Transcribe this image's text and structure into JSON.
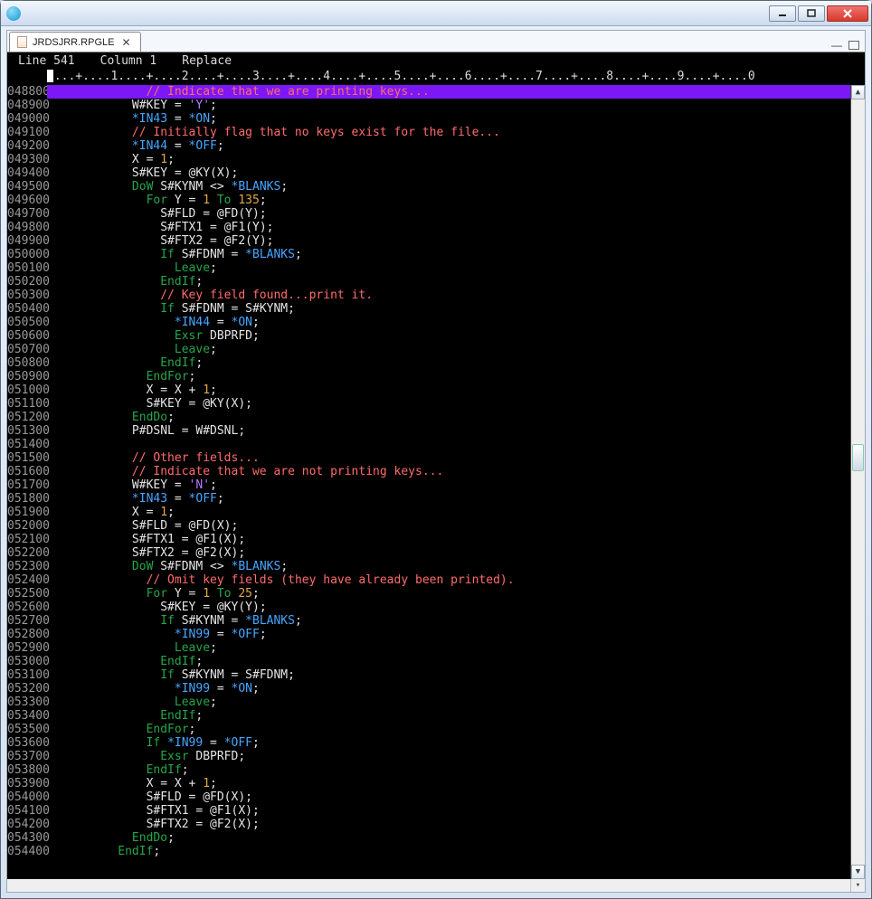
{
  "window": {
    "title": ""
  },
  "tab": {
    "label": "JRDSJRR.RPGLE"
  },
  "status": {
    "line_label": "Line",
    "line": "541",
    "col_label": "Column",
    "col": "1",
    "mode": "Replace"
  },
  "ruler": "....+....1....+....2....+....3....+....4....+....5....+....6....+....7....+....8....+....9....+....0",
  "code": [
    {
      "n": "048800",
      "sel": true,
      "segs": [
        [
          "sp",
          "              "
        ],
        [
          "c-comment",
          "// Indicate that we are printing keys..."
        ]
      ]
    },
    {
      "n": "048900",
      "segs": [
        [
          "sp",
          "            "
        ],
        [
          "c-id",
          "W#KEY "
        ],
        [
          "c-op",
          "= "
        ],
        [
          "c-str",
          "'Y'"
        ],
        [
          "c-id",
          ";"
        ]
      ]
    },
    {
      "n": "049000",
      "segs": [
        [
          "sp",
          "            "
        ],
        [
          "c-sp",
          "*IN43 "
        ],
        [
          "c-op",
          "= "
        ],
        [
          "c-sp",
          "*ON"
        ],
        [
          "c-id",
          ";"
        ]
      ]
    },
    {
      "n": "049100",
      "segs": [
        [
          "sp",
          "            "
        ],
        [
          "c-comment",
          "// Initially flag that no keys exist for the file..."
        ]
      ]
    },
    {
      "n": "049200",
      "segs": [
        [
          "sp",
          "            "
        ],
        [
          "c-sp",
          "*IN44 "
        ],
        [
          "c-op",
          "= "
        ],
        [
          "c-sp",
          "*OFF"
        ],
        [
          "c-id",
          ";"
        ]
      ]
    },
    {
      "n": "049300",
      "segs": [
        [
          "sp",
          "            "
        ],
        [
          "c-id",
          "X "
        ],
        [
          "c-op",
          "= "
        ],
        [
          "c-num",
          "1"
        ],
        [
          "c-id",
          ";"
        ]
      ]
    },
    {
      "n": "049400",
      "segs": [
        [
          "sp",
          "            "
        ],
        [
          "c-id",
          "S#KEY "
        ],
        [
          "c-op",
          "= "
        ],
        [
          "c-id",
          "@KY(X);"
        ]
      ]
    },
    {
      "n": "049500",
      "segs": [
        [
          "sp",
          "            "
        ],
        [
          "c-kw",
          "DoW "
        ],
        [
          "c-id",
          "S#KYNM "
        ],
        [
          "c-op",
          "<> "
        ],
        [
          "c-sp",
          "*BLANKS"
        ],
        [
          "c-id",
          ";"
        ]
      ]
    },
    {
      "n": "049600",
      "segs": [
        [
          "sp",
          "              "
        ],
        [
          "c-kw",
          "For "
        ],
        [
          "c-id",
          "Y "
        ],
        [
          "c-op",
          "= "
        ],
        [
          "c-num",
          "1"
        ],
        [
          "c-kw",
          " To "
        ],
        [
          "c-num",
          "135"
        ],
        [
          "c-id",
          ";"
        ]
      ]
    },
    {
      "n": "049700",
      "segs": [
        [
          "sp",
          "                "
        ],
        [
          "c-id",
          "S#FLD "
        ],
        [
          "c-op",
          "= "
        ],
        [
          "c-id",
          "@FD(Y);"
        ]
      ]
    },
    {
      "n": "049800",
      "segs": [
        [
          "sp",
          "                "
        ],
        [
          "c-id",
          "S#FTX1 "
        ],
        [
          "c-op",
          "= "
        ],
        [
          "c-id",
          "@F1(Y);"
        ]
      ]
    },
    {
      "n": "049900",
      "segs": [
        [
          "sp",
          "                "
        ],
        [
          "c-id",
          "S#FTX2 "
        ],
        [
          "c-op",
          "= "
        ],
        [
          "c-id",
          "@F2(Y);"
        ]
      ]
    },
    {
      "n": "050000",
      "segs": [
        [
          "sp",
          "                "
        ],
        [
          "c-kw",
          "If "
        ],
        [
          "c-id",
          "S#FDNM "
        ],
        [
          "c-op",
          "= "
        ],
        [
          "c-sp",
          "*BLANKS"
        ],
        [
          "c-id",
          ";"
        ]
      ]
    },
    {
      "n": "050100",
      "segs": [
        [
          "sp",
          "                  "
        ],
        [
          "c-kw",
          "Leave"
        ],
        [
          "c-id",
          ";"
        ]
      ]
    },
    {
      "n": "050200",
      "segs": [
        [
          "sp",
          "                "
        ],
        [
          "c-kw",
          "EndIf"
        ],
        [
          "c-id",
          ";"
        ]
      ]
    },
    {
      "n": "050300",
      "segs": [
        [
          "sp",
          "                "
        ],
        [
          "c-comment",
          "// Key field found...print it."
        ]
      ]
    },
    {
      "n": "050400",
      "segs": [
        [
          "sp",
          "                "
        ],
        [
          "c-kw",
          "If "
        ],
        [
          "c-id",
          "S#FDNM "
        ],
        [
          "c-op",
          "= "
        ],
        [
          "c-id",
          "S#KYNM;"
        ]
      ]
    },
    {
      "n": "050500",
      "segs": [
        [
          "sp",
          "                  "
        ],
        [
          "c-sp",
          "*IN44 "
        ],
        [
          "c-op",
          "= "
        ],
        [
          "c-sp",
          "*ON"
        ],
        [
          "c-id",
          ";"
        ]
      ]
    },
    {
      "n": "050600",
      "segs": [
        [
          "sp",
          "                  "
        ],
        [
          "c-kw",
          "Exsr "
        ],
        [
          "c-id",
          "DBPRFD;"
        ]
      ]
    },
    {
      "n": "050700",
      "segs": [
        [
          "sp",
          "                  "
        ],
        [
          "c-kw",
          "Leave"
        ],
        [
          "c-id",
          ";"
        ]
      ]
    },
    {
      "n": "050800",
      "segs": [
        [
          "sp",
          "                "
        ],
        [
          "c-kw",
          "EndIf"
        ],
        [
          "c-id",
          ";"
        ]
      ]
    },
    {
      "n": "050900",
      "segs": [
        [
          "sp",
          "              "
        ],
        [
          "c-kw",
          "EndFor"
        ],
        [
          "c-id",
          ";"
        ]
      ]
    },
    {
      "n": "051000",
      "segs": [
        [
          "sp",
          "              "
        ],
        [
          "c-id",
          "X "
        ],
        [
          "c-op",
          "= "
        ],
        [
          "c-id",
          "X "
        ],
        [
          "c-op",
          "+ "
        ],
        [
          "c-num",
          "1"
        ],
        [
          "c-id",
          ";"
        ]
      ]
    },
    {
      "n": "051100",
      "segs": [
        [
          "sp",
          "              "
        ],
        [
          "c-id",
          "S#KEY "
        ],
        [
          "c-op",
          "= "
        ],
        [
          "c-id",
          "@KY(X);"
        ]
      ]
    },
    {
      "n": "051200",
      "segs": [
        [
          "sp",
          "            "
        ],
        [
          "c-kw",
          "EndDo"
        ],
        [
          "c-id",
          ";"
        ]
      ]
    },
    {
      "n": "051300",
      "segs": [
        [
          "sp",
          "            "
        ],
        [
          "c-id",
          "P#DSNL "
        ],
        [
          "c-op",
          "= "
        ],
        [
          "c-id",
          "W#DSNL;"
        ]
      ]
    },
    {
      "n": "051400",
      "segs": [
        [
          "sp",
          ""
        ]
      ]
    },
    {
      "n": "051500",
      "segs": [
        [
          "sp",
          "            "
        ],
        [
          "c-comment",
          "// Other fields..."
        ]
      ]
    },
    {
      "n": "051600",
      "segs": [
        [
          "sp",
          "            "
        ],
        [
          "c-comment",
          "// Indicate that we are not printing keys..."
        ]
      ]
    },
    {
      "n": "051700",
      "segs": [
        [
          "sp",
          "            "
        ],
        [
          "c-id",
          "W#KEY "
        ],
        [
          "c-op",
          "= "
        ],
        [
          "c-str",
          "'N'"
        ],
        [
          "c-id",
          ";"
        ]
      ]
    },
    {
      "n": "051800",
      "segs": [
        [
          "sp",
          "            "
        ],
        [
          "c-sp",
          "*IN43 "
        ],
        [
          "c-op",
          "= "
        ],
        [
          "c-sp",
          "*OFF"
        ],
        [
          "c-id",
          ";"
        ]
      ]
    },
    {
      "n": "051900",
      "segs": [
        [
          "sp",
          "            "
        ],
        [
          "c-id",
          "X "
        ],
        [
          "c-op",
          "= "
        ],
        [
          "c-num",
          "1"
        ],
        [
          "c-id",
          ";"
        ]
      ]
    },
    {
      "n": "052000",
      "segs": [
        [
          "sp",
          "            "
        ],
        [
          "c-id",
          "S#FLD "
        ],
        [
          "c-op",
          "= "
        ],
        [
          "c-id",
          "@FD(X);"
        ]
      ]
    },
    {
      "n": "052100",
      "segs": [
        [
          "sp",
          "            "
        ],
        [
          "c-id",
          "S#FTX1 "
        ],
        [
          "c-op",
          "= "
        ],
        [
          "c-id",
          "@F1(X);"
        ]
      ]
    },
    {
      "n": "052200",
      "segs": [
        [
          "sp",
          "            "
        ],
        [
          "c-id",
          "S#FTX2 "
        ],
        [
          "c-op",
          "= "
        ],
        [
          "c-id",
          "@F2(X);"
        ]
      ]
    },
    {
      "n": "052300",
      "segs": [
        [
          "sp",
          "            "
        ],
        [
          "c-kw",
          "DoW "
        ],
        [
          "c-id",
          "S#FDNM "
        ],
        [
          "c-op",
          "<> "
        ],
        [
          "c-sp",
          "*BLANKS"
        ],
        [
          "c-id",
          ";"
        ]
      ]
    },
    {
      "n": "052400",
      "segs": [
        [
          "sp",
          "              "
        ],
        [
          "c-comment",
          "// Omit key fields (they have already been printed)."
        ]
      ]
    },
    {
      "n": "052500",
      "segs": [
        [
          "sp",
          "              "
        ],
        [
          "c-kw",
          "For "
        ],
        [
          "c-id",
          "Y "
        ],
        [
          "c-op",
          "= "
        ],
        [
          "c-num",
          "1"
        ],
        [
          "c-kw",
          " To "
        ],
        [
          "c-num",
          "25"
        ],
        [
          "c-id",
          ";"
        ]
      ]
    },
    {
      "n": "052600",
      "segs": [
        [
          "sp",
          "                "
        ],
        [
          "c-id",
          "S#KEY "
        ],
        [
          "c-op",
          "= "
        ],
        [
          "c-id",
          "@KY(Y);"
        ]
      ]
    },
    {
      "n": "052700",
      "segs": [
        [
          "sp",
          "                "
        ],
        [
          "c-kw",
          "If "
        ],
        [
          "c-id",
          "S#KYNM "
        ],
        [
          "c-op",
          "= "
        ],
        [
          "c-sp",
          "*BLANKS"
        ],
        [
          "c-id",
          ";"
        ]
      ]
    },
    {
      "n": "052800",
      "segs": [
        [
          "sp",
          "                  "
        ],
        [
          "c-sp",
          "*IN99 "
        ],
        [
          "c-op",
          "= "
        ],
        [
          "c-sp",
          "*OFF"
        ],
        [
          "c-id",
          ";"
        ]
      ]
    },
    {
      "n": "052900",
      "segs": [
        [
          "sp",
          "                  "
        ],
        [
          "c-kw",
          "Leave"
        ],
        [
          "c-id",
          ";"
        ]
      ]
    },
    {
      "n": "053000",
      "segs": [
        [
          "sp",
          "                "
        ],
        [
          "c-kw",
          "EndIf"
        ],
        [
          "c-id",
          ";"
        ]
      ]
    },
    {
      "n": "053100",
      "segs": [
        [
          "sp",
          "                "
        ],
        [
          "c-kw",
          "If "
        ],
        [
          "c-id",
          "S#KYNM "
        ],
        [
          "c-op",
          "= "
        ],
        [
          "c-id",
          "S#FDNM;"
        ]
      ]
    },
    {
      "n": "053200",
      "segs": [
        [
          "sp",
          "                  "
        ],
        [
          "c-sp",
          "*IN99 "
        ],
        [
          "c-op",
          "= "
        ],
        [
          "c-sp",
          "*ON"
        ],
        [
          "c-id",
          ";"
        ]
      ]
    },
    {
      "n": "053300",
      "segs": [
        [
          "sp",
          "                  "
        ],
        [
          "c-kw",
          "Leave"
        ],
        [
          "c-id",
          ";"
        ]
      ]
    },
    {
      "n": "053400",
      "segs": [
        [
          "sp",
          "                "
        ],
        [
          "c-kw",
          "EndIf"
        ],
        [
          "c-id",
          ";"
        ]
      ]
    },
    {
      "n": "053500",
      "segs": [
        [
          "sp",
          "              "
        ],
        [
          "c-kw",
          "EndFor"
        ],
        [
          "c-id",
          ";"
        ]
      ]
    },
    {
      "n": "053600",
      "segs": [
        [
          "sp",
          "              "
        ],
        [
          "c-kw",
          "If "
        ],
        [
          "c-sp",
          "*IN99 "
        ],
        [
          "c-op",
          "= "
        ],
        [
          "c-sp",
          "*OFF"
        ],
        [
          "c-id",
          ";"
        ]
      ]
    },
    {
      "n": "053700",
      "segs": [
        [
          "sp",
          "                "
        ],
        [
          "c-kw",
          "Exsr "
        ],
        [
          "c-id",
          "DBPRFD;"
        ]
      ]
    },
    {
      "n": "053800",
      "segs": [
        [
          "sp",
          "              "
        ],
        [
          "c-kw",
          "EndIf"
        ],
        [
          "c-id",
          ";"
        ]
      ]
    },
    {
      "n": "053900",
      "segs": [
        [
          "sp",
          "              "
        ],
        [
          "c-id",
          "X "
        ],
        [
          "c-op",
          "= "
        ],
        [
          "c-id",
          "X "
        ],
        [
          "c-op",
          "+ "
        ],
        [
          "c-num",
          "1"
        ],
        [
          "c-id",
          ";"
        ]
      ]
    },
    {
      "n": "054000",
      "segs": [
        [
          "sp",
          "              "
        ],
        [
          "c-id",
          "S#FLD "
        ],
        [
          "c-op",
          "= "
        ],
        [
          "c-id",
          "@FD(X);"
        ]
      ]
    },
    {
      "n": "054100",
      "segs": [
        [
          "sp",
          "              "
        ],
        [
          "c-id",
          "S#FTX1 "
        ],
        [
          "c-op",
          "= "
        ],
        [
          "c-id",
          "@F1(X);"
        ]
      ]
    },
    {
      "n": "054200",
      "segs": [
        [
          "sp",
          "              "
        ],
        [
          "c-id",
          "S#FTX2 "
        ],
        [
          "c-op",
          "= "
        ],
        [
          "c-id",
          "@F2(X);"
        ]
      ]
    },
    {
      "n": "054300",
      "segs": [
        [
          "sp",
          "            "
        ],
        [
          "c-kw",
          "EndDo"
        ],
        [
          "c-id",
          ";"
        ]
      ]
    },
    {
      "n": "054400",
      "segs": [
        [
          "sp",
          "          "
        ],
        [
          "c-kw",
          "EndIf"
        ],
        [
          "c-id",
          ";"
        ]
      ]
    }
  ]
}
